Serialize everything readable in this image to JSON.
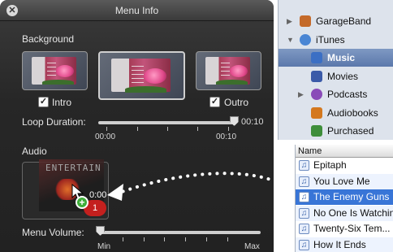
{
  "hud": {
    "title": "Menu Info",
    "close_glyph": "✕",
    "background_label": "Background",
    "intro_label": "Intro",
    "outro_label": "Outro",
    "intro_checked": true,
    "outro_checked": true,
    "check_glyph": "✓",
    "loop_duration_label": "Loop Duration:",
    "loop_duration_value": "00:10",
    "loop_duration_fraction": 1.0,
    "loop_tick_start": "00:00",
    "loop_tick_end": "00:10",
    "audio_label": "Audio",
    "menu_volume_label": "Menu Volume:",
    "menu_volume_fraction": 0.0,
    "volume_min": "Min",
    "volume_max": "Max"
  },
  "drag": {
    "album_text": "ENTERTAIN",
    "time": "0:00",
    "count_badge": "1",
    "plus_glyph": "+"
  },
  "source_list": {
    "items": [
      {
        "label": "GarageBand",
        "icon": "guitar-icon",
        "color": "#c46a2a",
        "disclosure": "▶"
      },
      {
        "label": "iTunes",
        "icon": "itunes-icon",
        "color": "#4a86d4",
        "disclosure": "▼"
      },
      {
        "label": "Music",
        "icon": "music-note-icon",
        "color": "#3b6fc4",
        "selected": true
      },
      {
        "label": "Movies",
        "icon": "movies-icon",
        "color": "#3a5aa8"
      },
      {
        "label": "Podcasts",
        "icon": "podcast-icon",
        "color": "#8a4bb8",
        "disclosure": "▶"
      },
      {
        "label": "Audiobooks",
        "icon": "audiobook-icon",
        "color": "#d4781e"
      },
      {
        "label": "Purchased",
        "icon": "purchased-icon",
        "color": "#3e8e3a"
      }
    ]
  },
  "song_list": {
    "header": "Name",
    "rows": [
      {
        "title": "Epitaph"
      },
      {
        "title": "You Love Me"
      },
      {
        "title": "The Enemy Guns",
        "selected": true
      },
      {
        "title": "No One Is Watching"
      },
      {
        "title": "Twenty-Six Tem..."
      },
      {
        "title": "How It Ends"
      }
    ]
  }
}
